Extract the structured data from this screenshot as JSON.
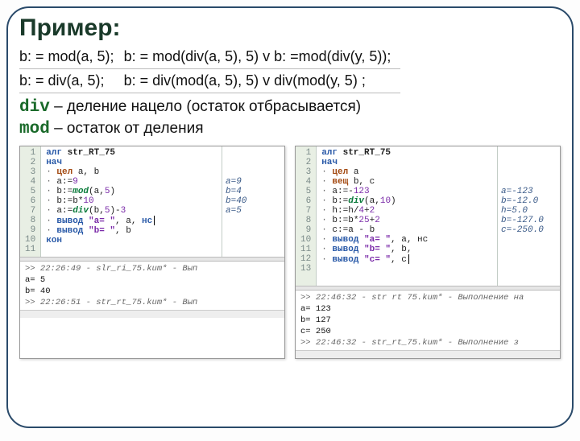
{
  "title": "Пример:",
  "table": {
    "r0c0": "b: = mod(a, 5);",
    "r0c1": "b: = mod(div(a, 5), 5) v b: =mod(div(y, 5));",
    "r1c0": "b: = div(a, 5);",
    "r1c1": "b: = div(mod(a, 5), 5) v div(mod(y, 5) ;"
  },
  "defs": {
    "div_kw": "div",
    "div_txt": " – деление нацело (остаток отбрасывается)",
    "mod_kw": "mod",
    "mod_txt": " – остаток от деления"
  },
  "left": {
    "lines": [
      "1",
      "2",
      "3",
      "4",
      "5",
      "6",
      "7",
      "8",
      "9",
      "10",
      "11"
    ],
    "l1_alg": "алг ",
    "l1_name": "str_RT_75",
    "l2": "нач",
    "l3_ty": "цел ",
    "l3_vars": "a, b",
    "l4a": "a",
    "l4b": ":=",
    "l4c": "9",
    "l5a": "b",
    "l5b": ":=",
    "l5fn": "mod",
    "l5c": "(a,",
    "l5n": "5",
    "l5d": ")",
    "l6a": "b",
    "l6b": ":=b*",
    "l6n": "10",
    "l7a": "a",
    "l7b": ":=",
    "l7fn": "div",
    "l7c": "(b,",
    "l7n": "5",
    "l7d": ")-",
    "l7n2": "3",
    "l8a": "вывод ",
    "l8s": "\"a= \"",
    "l8b": ", a, ",
    "l8nc": "нс",
    "l9a": "вывод ",
    "l9s": "\"b= \"",
    "l9b": ", b",
    "l10": "кон",
    "out": [
      "",
      "",
      "",
      "a=9",
      "b=4",
      "b=40",
      "a=5",
      "",
      "",
      "",
      ""
    ],
    "con1": ">> 22:26:49 - slr_ri_75.kum* - Вып",
    "con2a": "a= ",
    "con2b": "5",
    "con3a": "b= ",
    "con3b": "40",
    "con4": ">> 22:26:51 - str_rt_75.kum* - Вып"
  },
  "right": {
    "lines": [
      "1",
      "2",
      "3",
      "4",
      "5",
      "6",
      "7",
      "8",
      "9",
      "10",
      "11",
      "12",
      "13",
      ""
    ],
    "l1_alg": "алг ",
    "l1_name": "str_RT_75",
    "l2": "нач",
    "l3_ty": "цел ",
    "l3_vars": "a",
    "l4_ty": "вещ ",
    "l4_vars": "b, c",
    "l5a": "a",
    "l5b": ":=-",
    "l5n": "123",
    "l6a": "b",
    "l6b": ":=",
    "l6fn": "div",
    "l6c": "(a,",
    "l6n": "10",
    "l6d": ")",
    "l7a": "h",
    "l7b": ":=h/",
    "l7n": "4",
    "l7c": "+",
    "l7n2": "2",
    "l8a": "b",
    "l8b": ":=b*",
    "l8n": "25",
    "l8c": "+",
    "l8n2": "2",
    "l9a": "c",
    "l9b": ":=a - b",
    "l10a": "вывод ",
    "l10s": "\"a= \"",
    "l10b": ", a, нс",
    "l11a": "вывод ",
    "l11s": "\"b= \"",
    "l11b": ", b, ",
    "l12a": "вывод ",
    "l12s": "\"c= \"",
    "l12b": ", c",
    "out": [
      "",
      "",
      "",
      "",
      "a=-123",
      "b=-12.0",
      "h=5.0",
      "b=-127.0",
      "c=-250.0",
      "",
      "",
      "",
      "",
      ""
    ],
    "con1": ">> 22:46:32 - str rt 75.kum* - Выполнение на",
    "con2a": "a= ",
    "con2b": "123",
    "con3a": "b= ",
    "con3b": "127",
    "con4a": "c= ",
    "con4b": "250",
    "con5": ">> 22:46:32 - str_rt_75.kum* - Выполнение з"
  }
}
